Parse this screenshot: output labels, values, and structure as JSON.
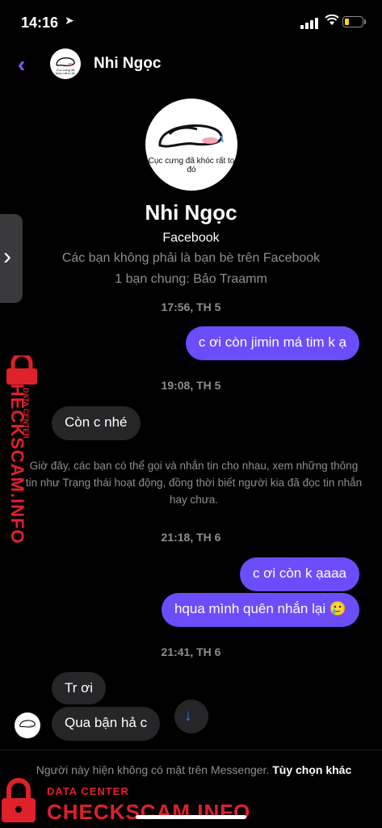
{
  "status": {
    "time": "14:16",
    "location_icon": "location-arrow-icon"
  },
  "header": {
    "name": "Nhi Ngọc"
  },
  "profile": {
    "avatar_caption": "Cục cưng đã khóc rất to đó",
    "name": "Nhi Ngọc",
    "source": "Facebook",
    "note": "Các bạn không phải là bạn bè trên Facebook",
    "mutual": "1 bạn chung: Bảo Traamm"
  },
  "messages": {
    "ts1": "17:56, TH 5",
    "m1": "c ơi còn jimin má tim k ạ",
    "ts2": "19:08, TH 5",
    "m2": "Còn c nhé",
    "system": "Giờ đây, các bạn có thể gọi và nhắn tin cho nhau, xem những thông tin như Trạng thái hoạt động, đồng thời biết người kia đã đọc tin nhắn hay chưa.",
    "ts3": "21:18, TH 6",
    "m3": "c ơi còn k ạaaa",
    "m4": "hqua mình quên nhắn lại 🥲",
    "ts4": "21:41, TH 6",
    "m5": "Tr ơi",
    "m6": "Qua bận hả c"
  },
  "footer": {
    "text": "Người này hiện không có mặt trên Messenger.",
    "link": "Tùy chọn khác"
  },
  "watermark": {
    "small": "DATA CENTER",
    "big": "CHECKSCAM.INFO",
    "small_side": "DATA CENTER",
    "big_side": "CHECKSCAM.INFO"
  },
  "colors": {
    "accent": "#8b5cf6",
    "outgoing": "#6b4dfc",
    "incoming": "#262628",
    "watermark": "#e0202a"
  }
}
